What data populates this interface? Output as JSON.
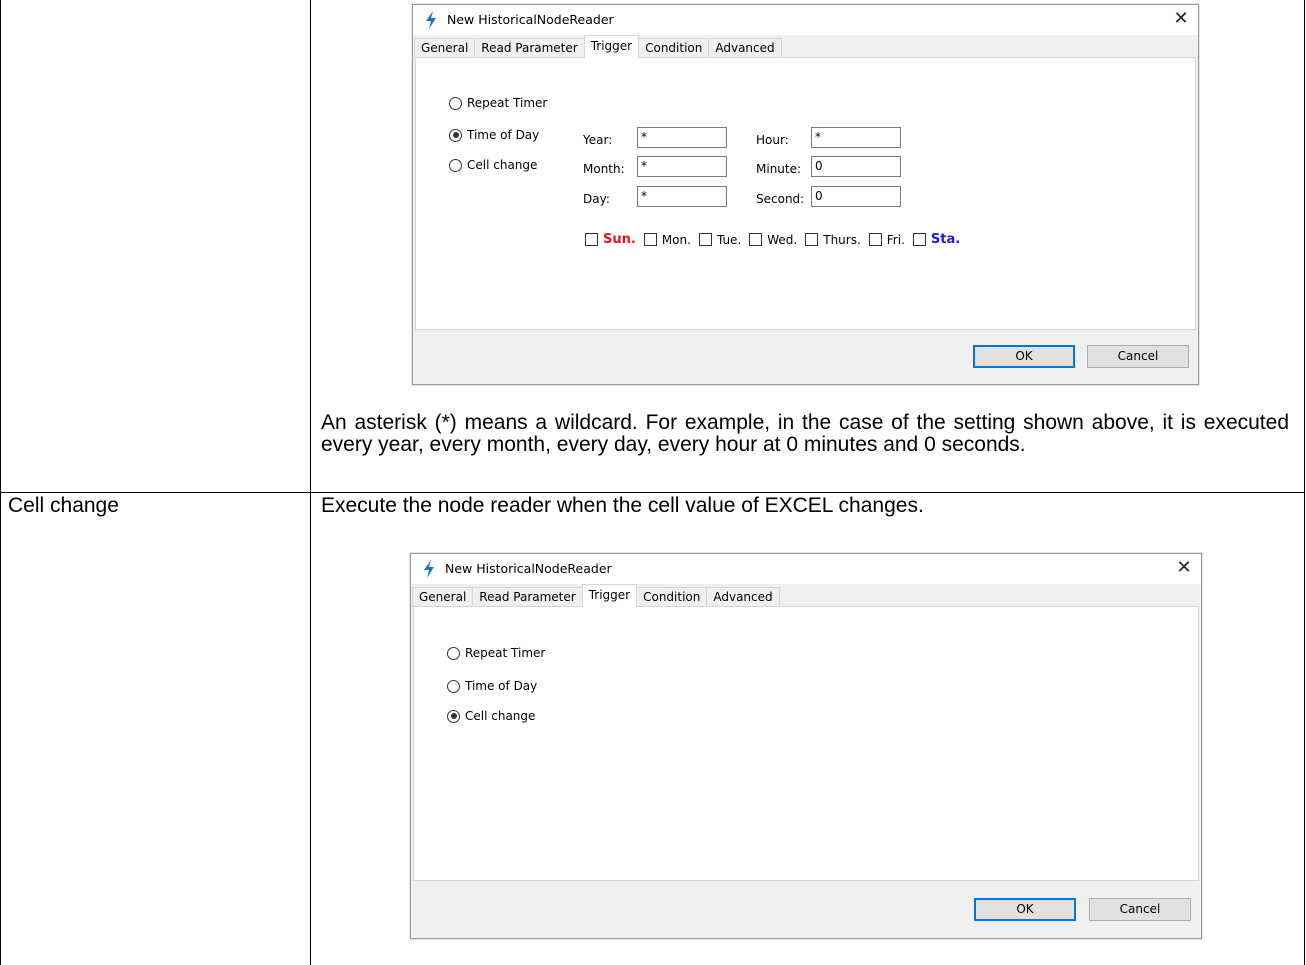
{
  "cells": {
    "description_1": "An asterisk (*) means a wildcard. For example, in the case of the setting shown above, it is executed every year, every month, every day, every hour at 0 minutes and 0 seconds.",
    "row_label": "Cell change",
    "description_2": "Execute the node reader when the cell value of EXCEL changes."
  },
  "dialog1": {
    "title": "New HistoricalNodeReader",
    "close": "✕",
    "tabs": [
      "General",
      "Read Parameter",
      "Trigger",
      "Condition",
      "Advanced"
    ],
    "active_tab": "Trigger",
    "options": [
      "Repeat Timer",
      "Time of Day",
      "Cell change"
    ],
    "selected_option": "Time of Day",
    "fields": {
      "year_label": "Year:",
      "year_value": "*",
      "month_label": "Month:",
      "month_value": "*",
      "day_label": "Day:",
      "day_value": "*",
      "hour_label": "Hour:",
      "hour_value": "*",
      "minute_label": "Minute:",
      "minute_value": "0",
      "second_label": "Second:",
      "second_value": "0"
    },
    "weekdays": [
      "Sun.",
      "Mon.",
      "Tue.",
      "Wed.",
      "Thurs.",
      "Fri.",
      "Sta."
    ],
    "ok": "OK",
    "cancel": "Cancel"
  },
  "dialog2": {
    "title": "New HistoricalNodeReader",
    "close": "✕",
    "tabs": [
      "General",
      "Read Parameter",
      "Trigger",
      "Condition",
      "Advanced"
    ],
    "active_tab": "Trigger",
    "options": [
      "Repeat Timer",
      "Time of Day",
      "Cell change"
    ],
    "selected_option": "Cell change",
    "ok": "OK",
    "cancel": "Cancel"
  },
  "colors": {
    "sunday": "#e8141c",
    "saturday": "#1a1adc",
    "default_button_border": "#0078d7",
    "lightning_icon": "#1f6fd0"
  }
}
